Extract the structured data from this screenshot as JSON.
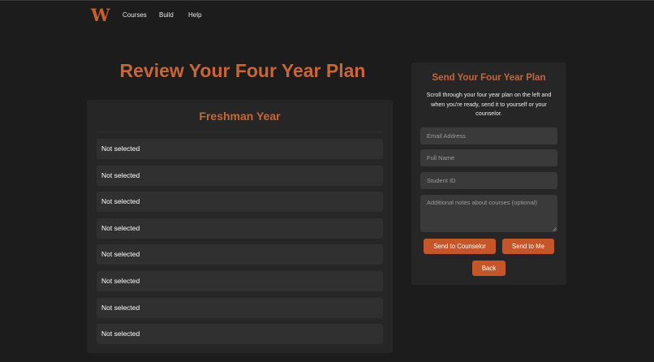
{
  "nav": {
    "logo": "W",
    "links": [
      "Courses",
      "Build",
      "Help"
    ]
  },
  "page": {
    "title": "Review Your Four Year Plan"
  },
  "plan": {
    "year_title": "Freshman Year",
    "slots": [
      "Not selected",
      "Not selected",
      "Not selected",
      "Not selected",
      "Not selected",
      "Not selected",
      "Not selected",
      "Not selected"
    ]
  },
  "send": {
    "title": "Send Your Four Year Plan",
    "description": "Scroll through your four year plan on the left and when you're ready, send it to yourself or your counselor.",
    "email_placeholder": "Email Address",
    "name_placeholder": "Full Name",
    "student_id_placeholder": "Student ID",
    "notes_placeholder": "Additional notes about courses (optional)",
    "send_counselor_label": "Send to Counselor",
    "send_me_label": "Send to Me",
    "back_label": "Back"
  },
  "colors": {
    "background": "#1c1c1c",
    "panel": "#262626",
    "slot": "#303030",
    "input": "#3a3a3a",
    "accent_text": "#c8663a",
    "button": "#c4562a"
  }
}
